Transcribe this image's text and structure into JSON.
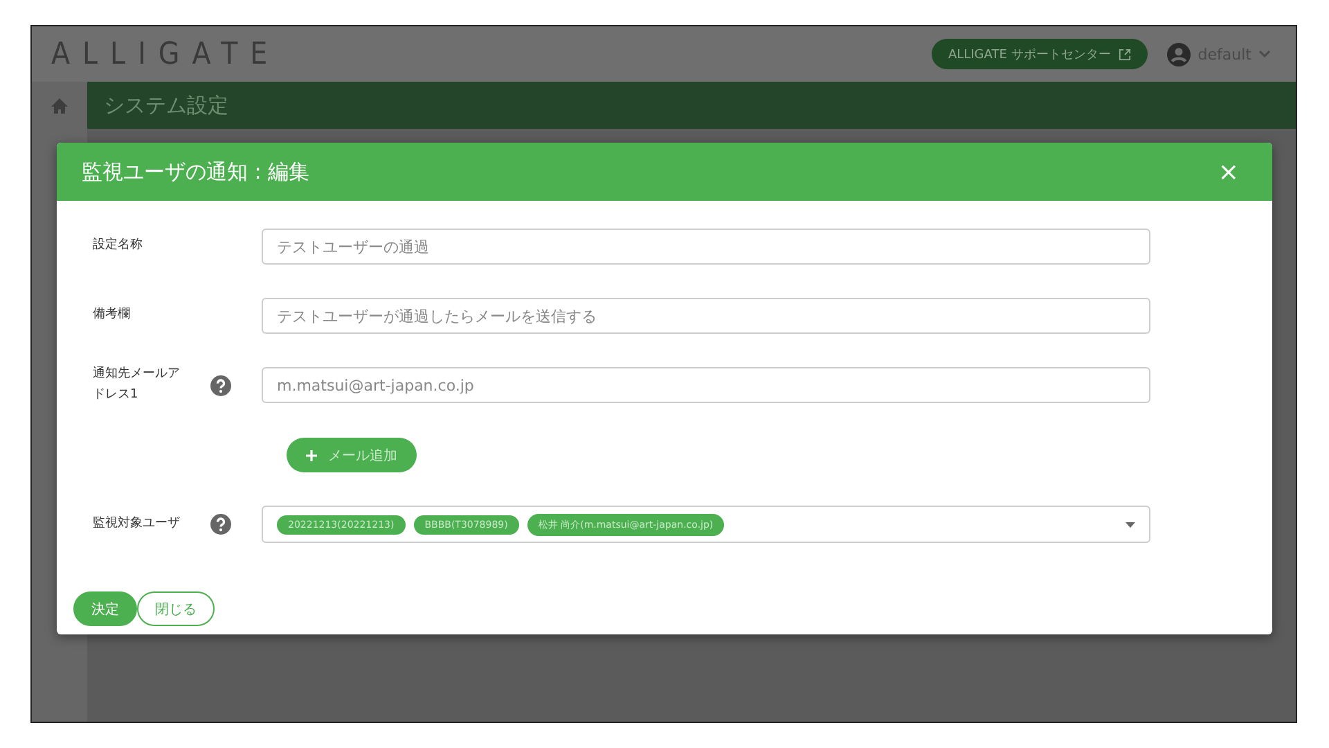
{
  "header": {
    "logo": "ALLIGATE",
    "support_button": "ALLIGATE サポートセンター",
    "user": "default"
  },
  "page_title": "システム設定",
  "modal": {
    "title": "監視ユーザの通知 : 編集",
    "close": "×",
    "fields": [
      {
        "kind": "text",
        "label": "設定名称",
        "help": false,
        "value": "テストユーザーの通過"
      },
      {
        "kind": "text",
        "label": "備考欄",
        "help": false,
        "value": "テストユーザーが通過したらメールを送信する"
      },
      {
        "kind": "text",
        "label": "通知先メールアドレス1",
        "help": true,
        "value": "m.matsui@art-japan.co.jp"
      },
      {
        "kind": "add",
        "label": "メール追加"
      },
      {
        "kind": "tags",
        "label": "監視対象ユーザ",
        "help": true,
        "tags": [
          "20221213(20221213)",
          "BBBB(T3078989)",
          "松井 尚介(m.matsui@art-japan.co.jp)"
        ]
      }
    ],
    "buttons": [
      {
        "label": "決定",
        "primary": true
      },
      {
        "label": "閉じる",
        "primary": false
      }
    ]
  }
}
